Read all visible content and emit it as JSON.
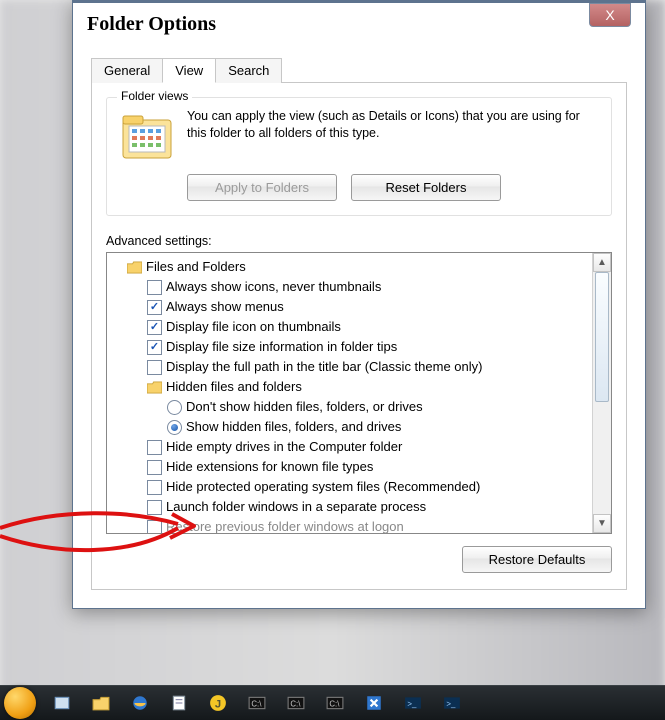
{
  "window": {
    "title": "Folder Options",
    "close_glyph": "X"
  },
  "tabs": {
    "general": "General",
    "view": "View",
    "search": "Search",
    "active": "view"
  },
  "folder_views": {
    "legend": "Folder views",
    "description": "You can apply the view (such as Details or Icons) that you are using for this folder to all folders of this type.",
    "apply_btn": "Apply to Folders",
    "reset_btn": "Reset Folders",
    "apply_enabled": false
  },
  "advanced": {
    "label": "Advanced settings:",
    "root": "Files and Folders",
    "items": [
      {
        "type": "check",
        "checked": false,
        "label": "Always show icons, never thumbnails"
      },
      {
        "type": "check",
        "checked": true,
        "label": "Always show menus"
      },
      {
        "type": "check",
        "checked": true,
        "label": "Display file icon on thumbnails"
      },
      {
        "type": "check",
        "checked": true,
        "label": "Display file size information in folder tips"
      },
      {
        "type": "check",
        "checked": false,
        "label": "Display the full path in the title bar (Classic theme only)"
      },
      {
        "type": "folder",
        "label": "Hidden files and folders"
      },
      {
        "type": "radio",
        "selected": false,
        "label": "Don't show hidden files, folders, or drives"
      },
      {
        "type": "radio",
        "selected": true,
        "label": "Show hidden files, folders, and drives"
      },
      {
        "type": "check",
        "checked": false,
        "label": "Hide empty drives in the Computer folder"
      },
      {
        "type": "check",
        "checked": false,
        "label": "Hide extensions for known file types"
      },
      {
        "type": "check",
        "checked": false,
        "label": "Hide protected operating system files (Recommended)"
      },
      {
        "type": "check",
        "checked": false,
        "label": "Launch folder windows in a separate process"
      },
      {
        "type": "check",
        "checked": false,
        "label": "Restore previous folder windows at logon",
        "cut": true
      }
    ],
    "restore_btn": "Restore Defaults"
  },
  "taskbar_icons": [
    "start",
    "generic",
    "explorer",
    "ie",
    "notepad",
    "j",
    "console1",
    "console2",
    "console3",
    "s",
    "ps1",
    "ps2"
  ]
}
